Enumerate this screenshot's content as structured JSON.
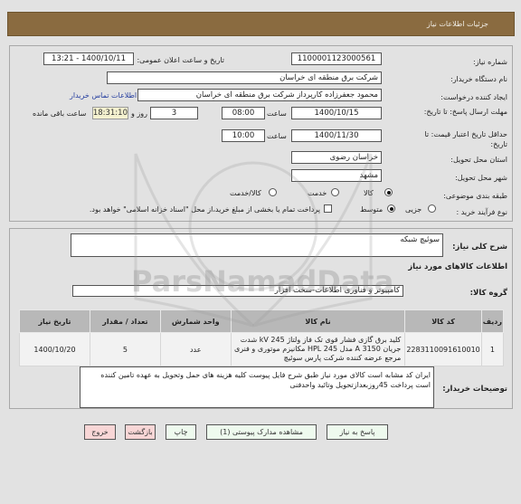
{
  "header": {
    "title": "جزئیات اطلاعات نیاز"
  },
  "form": {
    "need_number_label": "شماره نیاز:",
    "need_number": "1100001123000561",
    "announce_label": "تاریخ و ساعت اعلان عمومی:",
    "announce_value": "1400/10/11 - 13:21",
    "buyer_org_label": "نام دستگاه خریدار:",
    "buyer_org": "شرکت برق منطقه ای خراسان",
    "creator_label": "ایجاد کننده درخواست:",
    "creator": "محمود جعفرزاده کارپرداز شرکت برق منطقه ای خراسان",
    "contact_link": "اطلاعات تماس خریدار",
    "deadline_label": "مهلت ارسال پاسخ: تا تاریخ:",
    "deadline_date": "1400/10/15",
    "time_label": "ساعت",
    "deadline_time": "08:00",
    "days_value": "3",
    "days_label": "روز و",
    "remaining_time": "18:31:10",
    "remaining_label": "ساعت باقی مانده",
    "validity_label": "حداقل تاریخ اعتبار قیمت: تا تاریخ:",
    "validity_date": "1400/11/30",
    "validity_time": "10:00",
    "province_label": "استان محل تحویل:",
    "province": "خراسان رضوی",
    "city_label": "شهر محل تحویل:",
    "city": "مشهد",
    "category_label": "طبقه بندی موضوعی:",
    "category_options": [
      {
        "label": "کالا",
        "selected": true
      },
      {
        "label": "خدمت",
        "selected": false
      },
      {
        "label": "کالا/خدمت",
        "selected": false
      }
    ],
    "process_label": "نوع فرآیند خرید :",
    "process_options": [
      {
        "label": "جزیی",
        "selected": false
      },
      {
        "label": "متوسط",
        "selected": true
      }
    ],
    "payment_check_label": "پرداخت تمام یا بخشی از مبلغ خرید،از محل \"اسناد خزانه اسلامی\" خواهد بود.",
    "payment_checked": false
  },
  "details": {
    "summary_label": "شرح کلی نیاز:",
    "summary": "سوئیچ شبکه",
    "goods_info_title": "اطلاعات کالاهای مورد نیاز",
    "group_label": "گروه کالا:",
    "group": "کامپیوتر و فناوری اطلاعات-سخت افزار",
    "table": {
      "headers": [
        "ردیف",
        "کد کالا",
        "نام کالا",
        "واحد شمارش",
        "تعداد / مقدار",
        "تاریخ نیاز"
      ],
      "rows": [
        {
          "row": "1",
          "code": "2283110091610010",
          "name": "کلید برق گازی فشار قوی تک فاز ولتاژ 245 kV شدت جریان 3150 A مدل 245 HPL مکانیزم موتوری و فنری مرجع عرضه کننده شرکت پارس سوئیچ",
          "unit": "عدد",
          "qty": "5",
          "date": "1400/10/20"
        }
      ]
    },
    "buyer_notes_label": "توضیحات خریدار:",
    "buyer_notes": "ایران کد مشابه است کالای مورد نیاز طبق شرح فایل پیوست کلیه هزینه های حمل وتحویل به عهده تامین کننده است پرداخت 45روزبعدازتحویل وتائید واحدفنی"
  },
  "buttons": {
    "reply": "پاسخ به نیاز",
    "attachments": "مشاهده مدارک پیوستی (1)",
    "print": "چاپ",
    "back": "بازگشت",
    "exit": "خروج"
  },
  "watermark": {
    "text": "ParsNamadData"
  }
}
